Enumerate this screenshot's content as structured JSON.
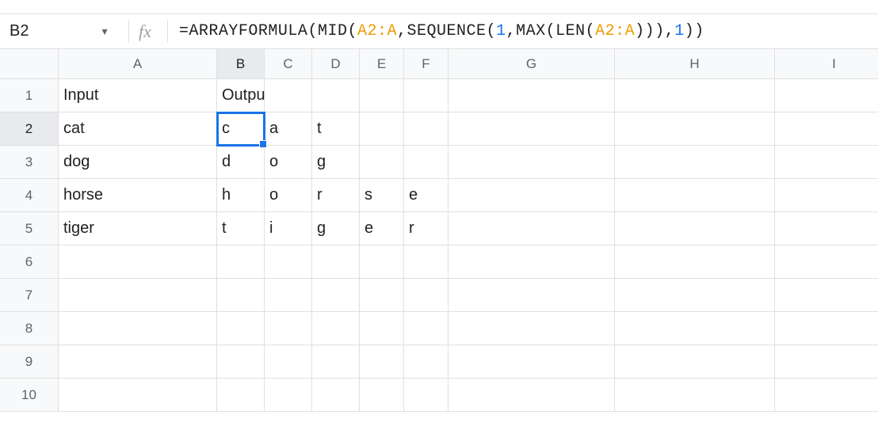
{
  "nameBox": {
    "cellRef": "B2"
  },
  "fxLabel": "fx",
  "formula": {
    "raw": "=ARRAYFORMULA(MID(A2:A,SEQUENCE(1,MAX(LEN(A2:A))),1))",
    "tokens": [
      {
        "t": "=",
        "c": "op"
      },
      {
        "t": "ARRAYFORMULA",
        "c": "fn"
      },
      {
        "t": "(",
        "c": "paren"
      },
      {
        "t": "MID",
        "c": "fn"
      },
      {
        "t": "(",
        "c": "paren"
      },
      {
        "t": "A2:A",
        "c": "ref"
      },
      {
        "t": ",",
        "c": "op"
      },
      {
        "t": "SEQUENCE",
        "c": "fn"
      },
      {
        "t": "(",
        "c": "paren"
      },
      {
        "t": "1",
        "c": "num"
      },
      {
        "t": ",",
        "c": "op"
      },
      {
        "t": "MAX",
        "c": "fn"
      },
      {
        "t": "(",
        "c": "paren"
      },
      {
        "t": "LEN",
        "c": "fn"
      },
      {
        "t": "(",
        "c": "paren"
      },
      {
        "t": "A2:A",
        "c": "ref"
      },
      {
        "t": ")",
        "c": "paren"
      },
      {
        "t": ")",
        "c": "paren"
      },
      {
        "t": ")",
        "c": "paren"
      },
      {
        "t": ",",
        "c": "op"
      },
      {
        "t": "1",
        "c": "num"
      },
      {
        "t": ")",
        "c": "paren"
      },
      {
        "t": ")",
        "c": "paren"
      }
    ]
  },
  "columns": [
    "A",
    "B",
    "C",
    "D",
    "E",
    "F",
    "G",
    "H",
    "I"
  ],
  "activeColumn": "B",
  "rows": [
    1,
    2,
    3,
    4,
    5,
    6,
    7,
    8,
    9,
    10
  ],
  "activeRow": 2,
  "selectedCell": "B2",
  "cells": {
    "A1": "Input",
    "B1": "Output",
    "A2": "cat",
    "B2": "c",
    "C2": "a",
    "D2": "t",
    "A3": "dog",
    "B3": "d",
    "C3": "o",
    "D3": "g",
    "A4": "horse",
    "B4": "h",
    "C4": "o",
    "D4": "r",
    "E4": "s",
    "F4": "e",
    "A5": "tiger",
    "B5": "t",
    "C5": "i",
    "D5": "g",
    "E5": "e",
    "F5": "r"
  }
}
